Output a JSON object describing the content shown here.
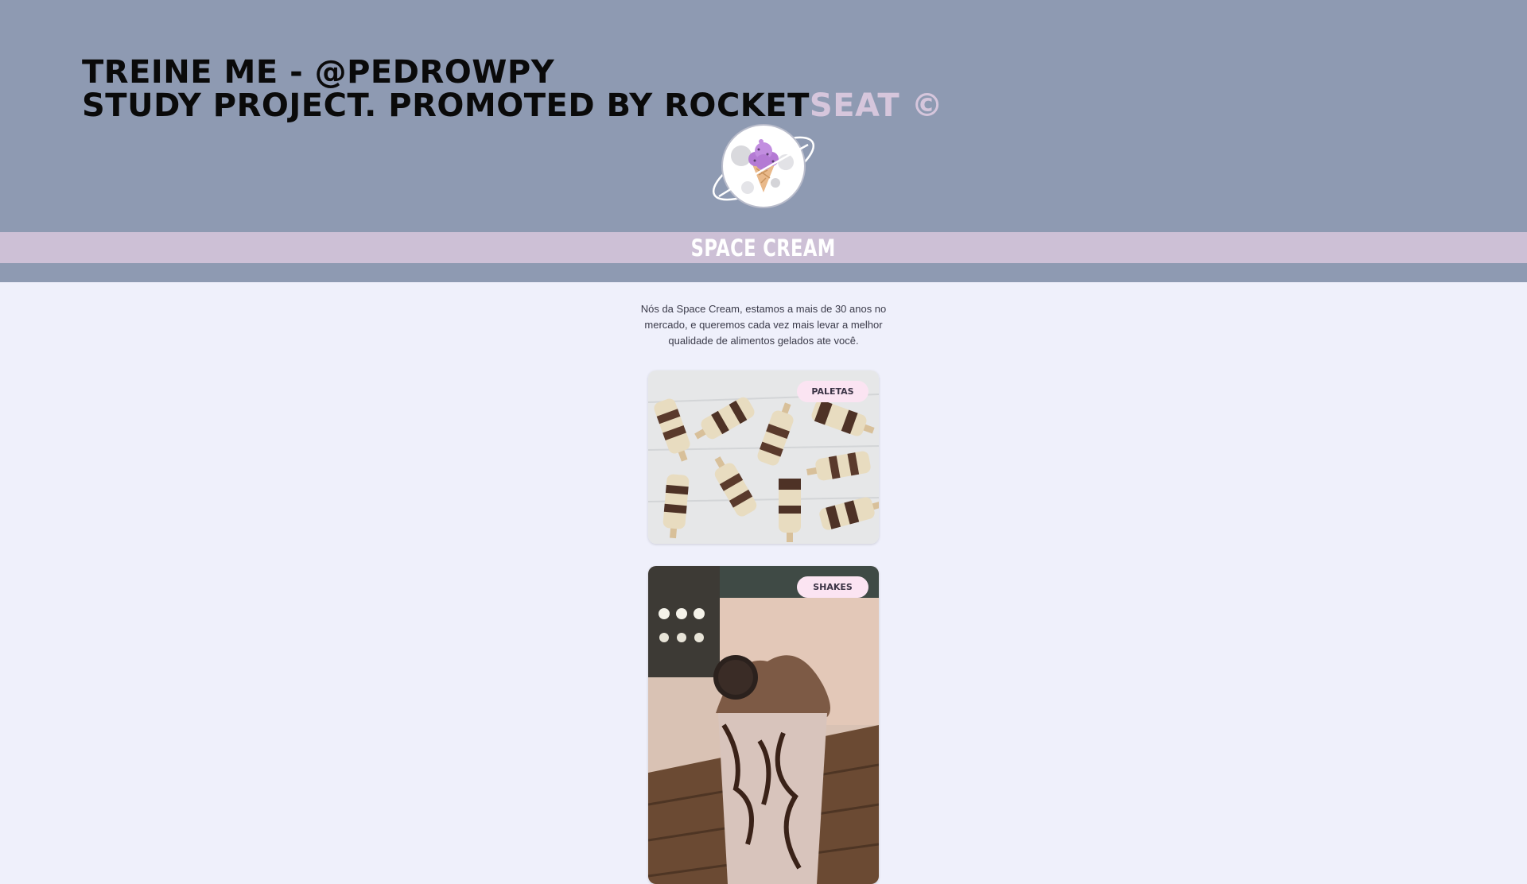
{
  "header": {
    "headline_line1": "TREINE ME - @PEDROWPY",
    "headline_line2_main": "STUDY PROJECT. PROMOTED BY ROCKET",
    "headline_line2_accent": "SEAT ©",
    "background": "#8e9ab2",
    "accent_color": "#d6c6dc"
  },
  "logo": {
    "icon": "ice-cream-planet-logo-icon"
  },
  "brand": {
    "title": "SPACE CREAM",
    "bar_color": "#cdc0d6"
  },
  "main": {
    "intro": "Nós da Space Cream, estamos a mais de 30 anos no mercado, e queremos cada vez mais levar a melhor qualidade de alimentos gelados ate você.",
    "background": "#eff0fb"
  },
  "products": [
    {
      "label": "PALETAS",
      "image": "popsicles-image"
    },
    {
      "label": "SHAKES",
      "image": "milkshake-image"
    }
  ]
}
